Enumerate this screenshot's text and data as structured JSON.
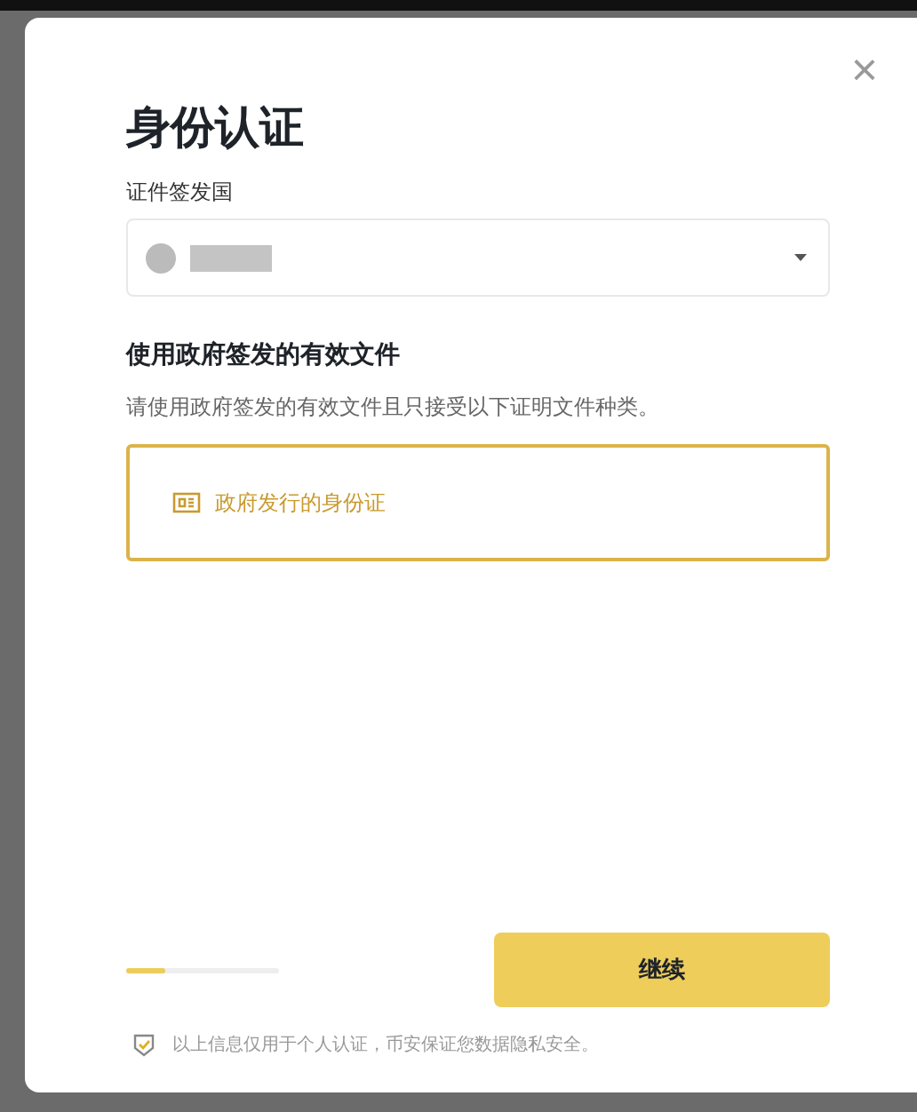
{
  "dialog": {
    "title": "身份认证",
    "close": "×"
  },
  "country": {
    "label": "证件签发国"
  },
  "documents": {
    "heading": "使用政府签发的有效文件",
    "note": "请使用政府签发的有效文件且只接受以下证明文件种类。",
    "options": [
      {
        "label": "政府发行的身份证",
        "selected": true
      }
    ]
  },
  "progress": {
    "level": 0.25
  },
  "continue_button": "继续",
  "footer": "以上信息仅用于个人认证，币安保证您数据隐私安全。"
}
